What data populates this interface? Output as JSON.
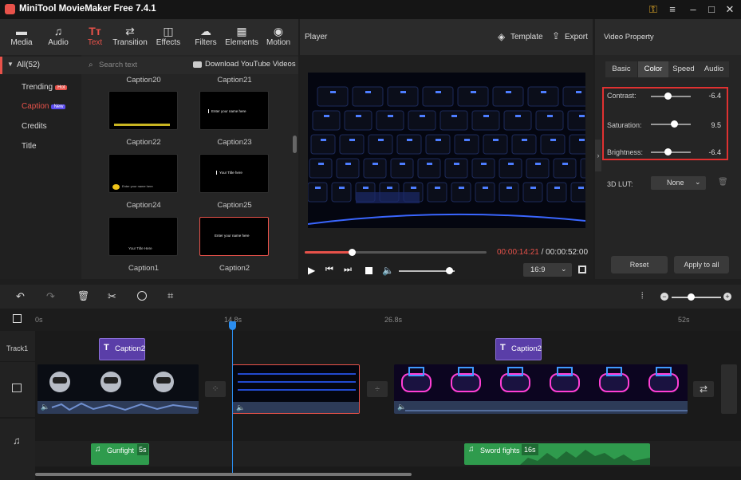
{
  "app": {
    "title": "MiniTool MovieMaker Free 7.4.1",
    "window_icons": [
      "key-icon",
      "menu-icon",
      "minimize-icon",
      "maximize-icon",
      "close-icon"
    ]
  },
  "toolbar": {
    "items": [
      {
        "label": "Media",
        "icon": "folder-icon"
      },
      {
        "label": "Audio",
        "icon": "music-note-icon"
      },
      {
        "label": "Text",
        "icon": "text-icon",
        "active": true
      },
      {
        "label": "Transition",
        "icon": "transition-icon"
      },
      {
        "label": "Effects",
        "icon": "effects-icon"
      },
      {
        "label": "Filters",
        "icon": "filters-icon"
      },
      {
        "label": "Elements",
        "icon": "elements-icon"
      },
      {
        "label": "Motion",
        "icon": "motion-icon"
      }
    ]
  },
  "library": {
    "all_label": "All(52)",
    "search_placeholder": "Search text",
    "download_label": "Download YouTube Videos",
    "categories": [
      {
        "label": "Trending",
        "badge": "Hot"
      },
      {
        "label": "Caption",
        "badge": "New",
        "active": true
      },
      {
        "label": "Credits",
        "badge": ""
      },
      {
        "label": "Title",
        "badge": ""
      }
    ],
    "thumb_cut_labels": [
      "Caption20",
      "Caption21"
    ],
    "thumbnails": [
      {
        "label": "Caption22",
        "text": ""
      },
      {
        "label": "Caption23",
        "text": "Enter your name here"
      },
      {
        "label": "Caption24",
        "text": "Enter your name here"
      },
      {
        "label": "Caption25",
        "text": "Your Title here"
      },
      {
        "label": "Caption1",
        "text": "Your Title Here"
      },
      {
        "label": "Caption2",
        "text": "Enter your name here",
        "selected": true
      }
    ]
  },
  "player": {
    "title": "Player",
    "template_label": "Template",
    "export_label": "Export",
    "current_time": "00:00:14:21",
    "separator": "/",
    "total_time": "00:00:52:00",
    "progress": 0.26,
    "volume": 0.9,
    "aspect": "16:9"
  },
  "property": {
    "title": "Video Property",
    "tabs": [
      "Basic",
      "Color",
      "Speed",
      "Audio"
    ],
    "active_tab": "Color",
    "contrast": {
      "label": "Contrast:",
      "value": "-6.4",
      "level": 0.42
    },
    "saturation": {
      "label": "Saturation:",
      "value": "9.5",
      "level": 0.58
    },
    "brightness": {
      "label": "Brightness:",
      "value": "-6.4",
      "level": 0.42
    },
    "lut": {
      "label": "3D LUT:",
      "value": "None"
    },
    "reset_label": "Reset",
    "apply_label": "Apply to all"
  },
  "timeline": {
    "ruler": [
      "0s",
      "14.8s",
      "26.8s",
      "52s"
    ],
    "track_label": "Track1",
    "captions": [
      "Caption2",
      "Caption2"
    ],
    "audio": [
      {
        "name": "Gunfight",
        "duration": "5s"
      },
      {
        "name": "Sword fights",
        "duration": "16s"
      }
    ]
  },
  "colors": {
    "accent": "#e8524a",
    "caption": "#5a3ea8",
    "audio": "#2f9b4d",
    "playhead": "#2b8ef0",
    "highlight": "#e03131"
  }
}
